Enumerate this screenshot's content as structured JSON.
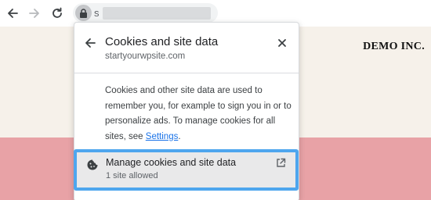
{
  "browser": {
    "url_visible_char": "s"
  },
  "page": {
    "brand": "DEMO INC."
  },
  "popup": {
    "title": "Cookies and site data",
    "site": "startyourwpsite.com",
    "description_text": "Cookies and other site data are used to remember you, for example to sign you in or to personalize ads. To manage cookies for all sites, see ",
    "settings_link": "Settings",
    "description_end": ".",
    "manage_row": {
      "label": "Manage cookies and site data",
      "sublabel": "1 site allowed",
      "highlight_color": "#4ea6ee"
    }
  },
  "icons": {
    "back": "arrow-left-icon",
    "forward": "arrow-right-icon",
    "reload": "reload-icon",
    "lock": "lock-icon",
    "popup_back": "arrow-left-icon",
    "close": "close-icon",
    "cookie": "cookie-icon",
    "external": "external-link-icon"
  }
}
